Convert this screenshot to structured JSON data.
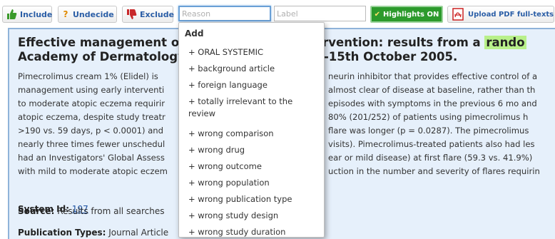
{
  "toolbar": {
    "include_label": "Include",
    "undecide_label": "Undecide",
    "exclude_label": "Exclude",
    "reason_placeholder": "Reason",
    "label_placeholder": "Label",
    "highlights_label": "Highlights ON",
    "upload_label": "Upload PDF full-texts"
  },
  "article": {
    "title_line1_a": "Effective management of",
    "title_line1_b": "rly intervention: results from a",
    "title_highlight": "rando",
    "title_line2_a": "Academy of Dermatology",
    "title_line2_b": "lon,UK. 12-15th October 2005.",
    "abstract_lines": [
      [
        "Pimecrolimus cream 1% (Elidel) is",
        "neurin inhibitor that provides effective control of a"
      ],
      [
        "management using early interventi",
        "almost clear of disease at baseline, rather than th"
      ],
      [
        "to moderate atopic eczema requirir",
        "episodes with symptoms in the previous 6 mo and"
      ],
      [
        "atopic eczema, despite study treatr",
        "80% (201/252) of patients using pimecrolimus h"
      ],
      [
        ">190 vs. 59 days, p < 0.0001) and",
        "flare was longer (p = 0.0287). The pimecrolimus"
      ],
      [
        "nearly three times fewer unschedul",
        "visits). Pimecrolimus-treated patients also had les"
      ],
      [
        "had an Investigators' Global Assess",
        "ear or mild disease) at first flare (59.3 vs. 41.9%)"
      ],
      [
        "with mild to moderate atopic eczem",
        "uction in the number and severity of flares requirin"
      ]
    ],
    "system_id_label": "System Id:",
    "system_id_value": "197",
    "source_label": "Source:",
    "source_value": "Results from all searches",
    "pubtypes_label": "Publication Types:",
    "pubtypes_value": "Journal Article"
  },
  "dropdown": {
    "header": "Add",
    "items": [
      "+ ORAL SYSTEMIC",
      "+ background article",
      "+ foreign language",
      "+ totally irrelevant to the review",
      "+ wrong comparison",
      "+ wrong drug",
      "+ wrong outcome",
      "+ wrong population",
      "+ wrong publication type",
      "+ wrong study design",
      "+ wrong study duration"
    ]
  },
  "colors": {
    "highlights_bg": "#2c9a2c",
    "panel_bg": "#e6f0fb",
    "title_highlight": "#b8f08a",
    "link": "#1a4fa0"
  }
}
